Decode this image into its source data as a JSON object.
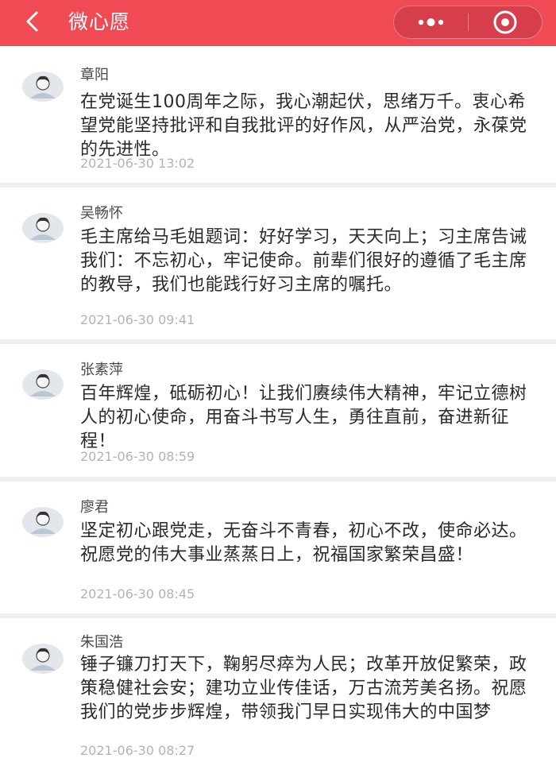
{
  "header": {
    "title": "微心愿",
    "back_icon": "back-chevron-icon",
    "more_icon": "more-dots-icon",
    "close_icon": "target-circle-icon",
    "background_color": "#f04a55"
  },
  "comments": [
    {
      "name": "章阳",
      "text": "在党诞生100周年之际，我心潮起伏，思绪万千。衷心希望党能坚持批评和自我批评的好作风，从严治党，永葆党的先进性。",
      "time": "2021-06-30 13:02"
    },
    {
      "name": "吴畅怀",
      "text": "毛主席给马毛姐题词：好好学习，天天向上；习主席告诫我们：不忘初心，牢记使命。前辈们很好的遵循了毛主席的教导，我们也能践行好习主席的嘱托。",
      "time": "2021-06-30 09:41"
    },
    {
      "name": "张素萍",
      "text": "百年辉煌，砥砺初心！让我们赓续伟大精神，牢记立德树人的初心使命，用奋斗书写人生，勇往直前，奋进新征程！",
      "time": "2021-06-30 08:59"
    },
    {
      "name": "廖君",
      "text": "坚定初心跟党走，无奋斗不青春，初心不改，使命必达。祝愿党的伟大事业蒸蒸日上，祝福国家繁荣昌盛！",
      "time": "2021-06-30 08:45"
    },
    {
      "name": "朱国浩",
      "text": "锤子镰刀打天下，鞠躬尽瘁为人民；改革开放促繁荣，政策稳健社会安；建功立业传佳话，万古流芳美名扬。祝愿我们的党步步辉煌，带领我门早日实现伟大的中国梦",
      "time": "2021-06-30 08:27"
    }
  ]
}
